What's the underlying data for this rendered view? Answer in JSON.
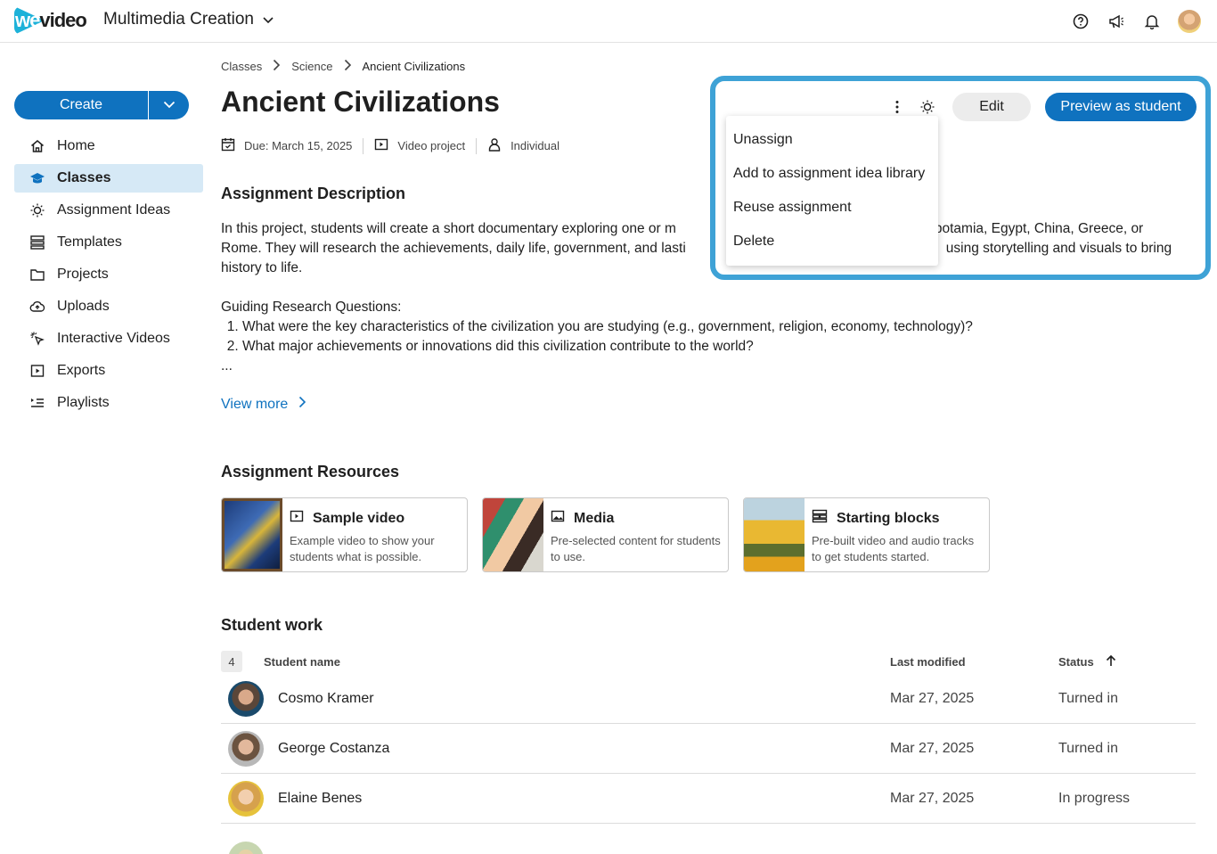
{
  "header": {
    "logo_text": "wevideo",
    "logo_we": "we",
    "logo_video": "video",
    "app_title": "Multimedia Creation"
  },
  "sidebar": {
    "create_label": "Create",
    "items": [
      {
        "label": "Home",
        "icon": "home-icon"
      },
      {
        "label": "Classes",
        "icon": "graduation-cap-icon",
        "active": true
      },
      {
        "label": "Assignment Ideas",
        "icon": "lightbulb-icon"
      },
      {
        "label": "Templates",
        "icon": "templates-icon"
      },
      {
        "label": "Projects",
        "icon": "folder-icon"
      },
      {
        "label": "Uploads",
        "icon": "cloud-upload-icon"
      },
      {
        "label": "Interactive Videos",
        "icon": "pointer-click-icon"
      },
      {
        "label": "Exports",
        "icon": "export-video-icon"
      },
      {
        "label": "Playlists",
        "icon": "playlist-icon"
      }
    ]
  },
  "breadcrumb": [
    "Classes",
    "Science",
    "Ancient Civilizations"
  ],
  "page": {
    "title": "Ancient Civilizations",
    "due": "Due: March 15, 2025",
    "type": "Video project",
    "mode": "Individual"
  },
  "actions": {
    "edit": "Edit",
    "preview": "Preview as student",
    "menu": [
      "Unassign",
      "Add to assignment idea library",
      "Reuse assignment",
      "Delete"
    ]
  },
  "description": {
    "heading": "Assignment Description",
    "intro_before": "In this project, students will create a short documentary exploring one or m",
    "intro_after": "esopotamia, Egypt, China, Greece, or",
    "line2_before": "Rome. They will research the achievements, daily life, government, and lasti",
    "line2_after": "using storytelling and visuals to bring",
    "line3": "history to life.",
    "guiding": "Guiding Research Questions:",
    "questions": [
      "What were the key characteristics of the civilization you are studying (e.g., government, religion, economy, technology)?",
      "What major achievements or innovations did this civilization contribute to the world?"
    ],
    "ellipsis": "...",
    "view_more": "View more"
  },
  "resources": {
    "heading": "Assignment Resources",
    "cards": [
      {
        "title": "Sample video",
        "desc": "Example video to show your students what is possible.",
        "icon": "video-icon"
      },
      {
        "title": "Media",
        "desc": "Pre-selected content for students to use.",
        "icon": "image-icon"
      },
      {
        "title": "Starting blocks",
        "desc": "Pre-built video and audio tracks to get students started.",
        "icon": "starting-blocks-icon"
      }
    ]
  },
  "student_work": {
    "heading": "Student work",
    "count": "4",
    "columns": {
      "name": "Student name",
      "modified": "Last modified",
      "status": "Status"
    },
    "rows": [
      {
        "name": "Cosmo Kramer",
        "modified": "Mar 27, 2025",
        "status": "Turned in"
      },
      {
        "name": "George Costanza",
        "modified": "Mar 27, 2025",
        "status": "Turned in"
      },
      {
        "name": "Elaine Benes",
        "modified": "Mar 27, 2025",
        "status": "In progress"
      }
    ]
  },
  "colors": {
    "primary": "#0f72bf",
    "highlight": "#3ea2d6",
    "logo": "#1db2d9",
    "active_nav": "#d6e9f6"
  }
}
